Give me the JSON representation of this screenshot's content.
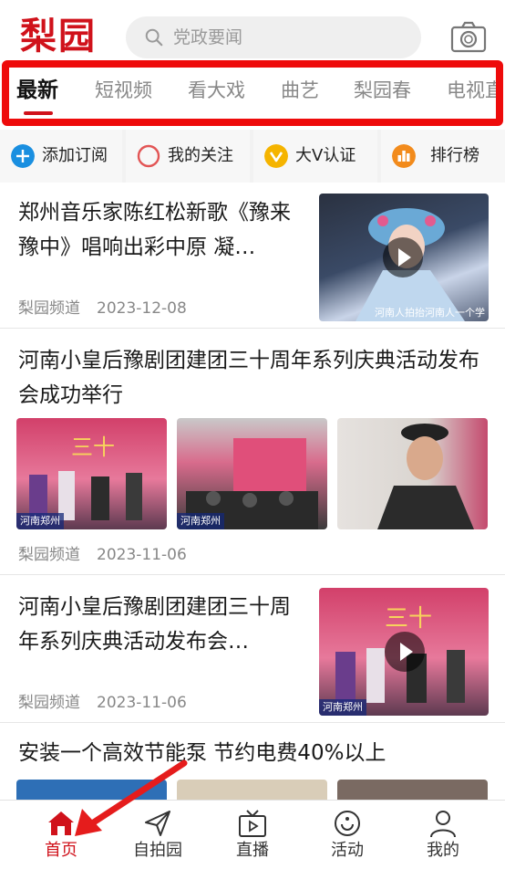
{
  "header": {
    "logo": "梨园",
    "search_placeholder": "党政要闻"
  },
  "tabs": [
    {
      "label": "最新",
      "active": true
    },
    {
      "label": "短视频",
      "active": false
    },
    {
      "label": "看大戏",
      "active": false
    },
    {
      "label": "曲艺",
      "active": false
    },
    {
      "label": "梨园春",
      "active": false
    },
    {
      "label": "电视直",
      "active": false
    }
  ],
  "quick_actions": [
    {
      "label": "添加订阅",
      "icon": "plus-circle-icon",
      "color": "#1a8fe0"
    },
    {
      "label": "我的关注",
      "icon": "circle-icon",
      "color": "#e25555"
    },
    {
      "label": "大V认证",
      "icon": "v-badge-icon",
      "color": "#f5b400"
    },
    {
      "label": "排行榜",
      "icon": "bar-chart-icon",
      "color": "#f28b1c"
    }
  ],
  "feed": [
    {
      "title": "郑州音乐家陈红松新歌《豫来豫中》唱响出彩中原 凝…",
      "source": "梨园频道",
      "date": "2023-12-08",
      "thumb_caption": "河南人拍抬河南人一个学"
    },
    {
      "title": "河南小皇后豫剧团建团三十周年系列庆典活动发布会成功举行",
      "source": "梨园频道",
      "date": "2023-11-06",
      "thumb_captions": [
        "河南郑州",
        "河南郑州",
        ""
      ]
    },
    {
      "title": "河南小皇后豫剧团建团三十周年系列庆典活动发布会…",
      "source": "梨园频道",
      "date": "2023-11-06",
      "thumb_caption": "河南郑州"
    },
    {
      "title": "安装一个高效节能泵 节约电费40%以上"
    }
  ],
  "bottom_nav": [
    {
      "label": "首页",
      "icon": "home-icon",
      "active": true
    },
    {
      "label": "自拍园",
      "icon": "send-icon",
      "active": false
    },
    {
      "label": "直播",
      "icon": "tv-icon",
      "active": false
    },
    {
      "label": "活动",
      "icon": "activity-icon",
      "active": false
    },
    {
      "label": "我的",
      "icon": "user-icon",
      "active": false
    }
  ],
  "colors": {
    "brand_red": "#d0121b",
    "highlight_frame": "#ee0b0b",
    "annotation_arrow": "#e51c1c"
  }
}
